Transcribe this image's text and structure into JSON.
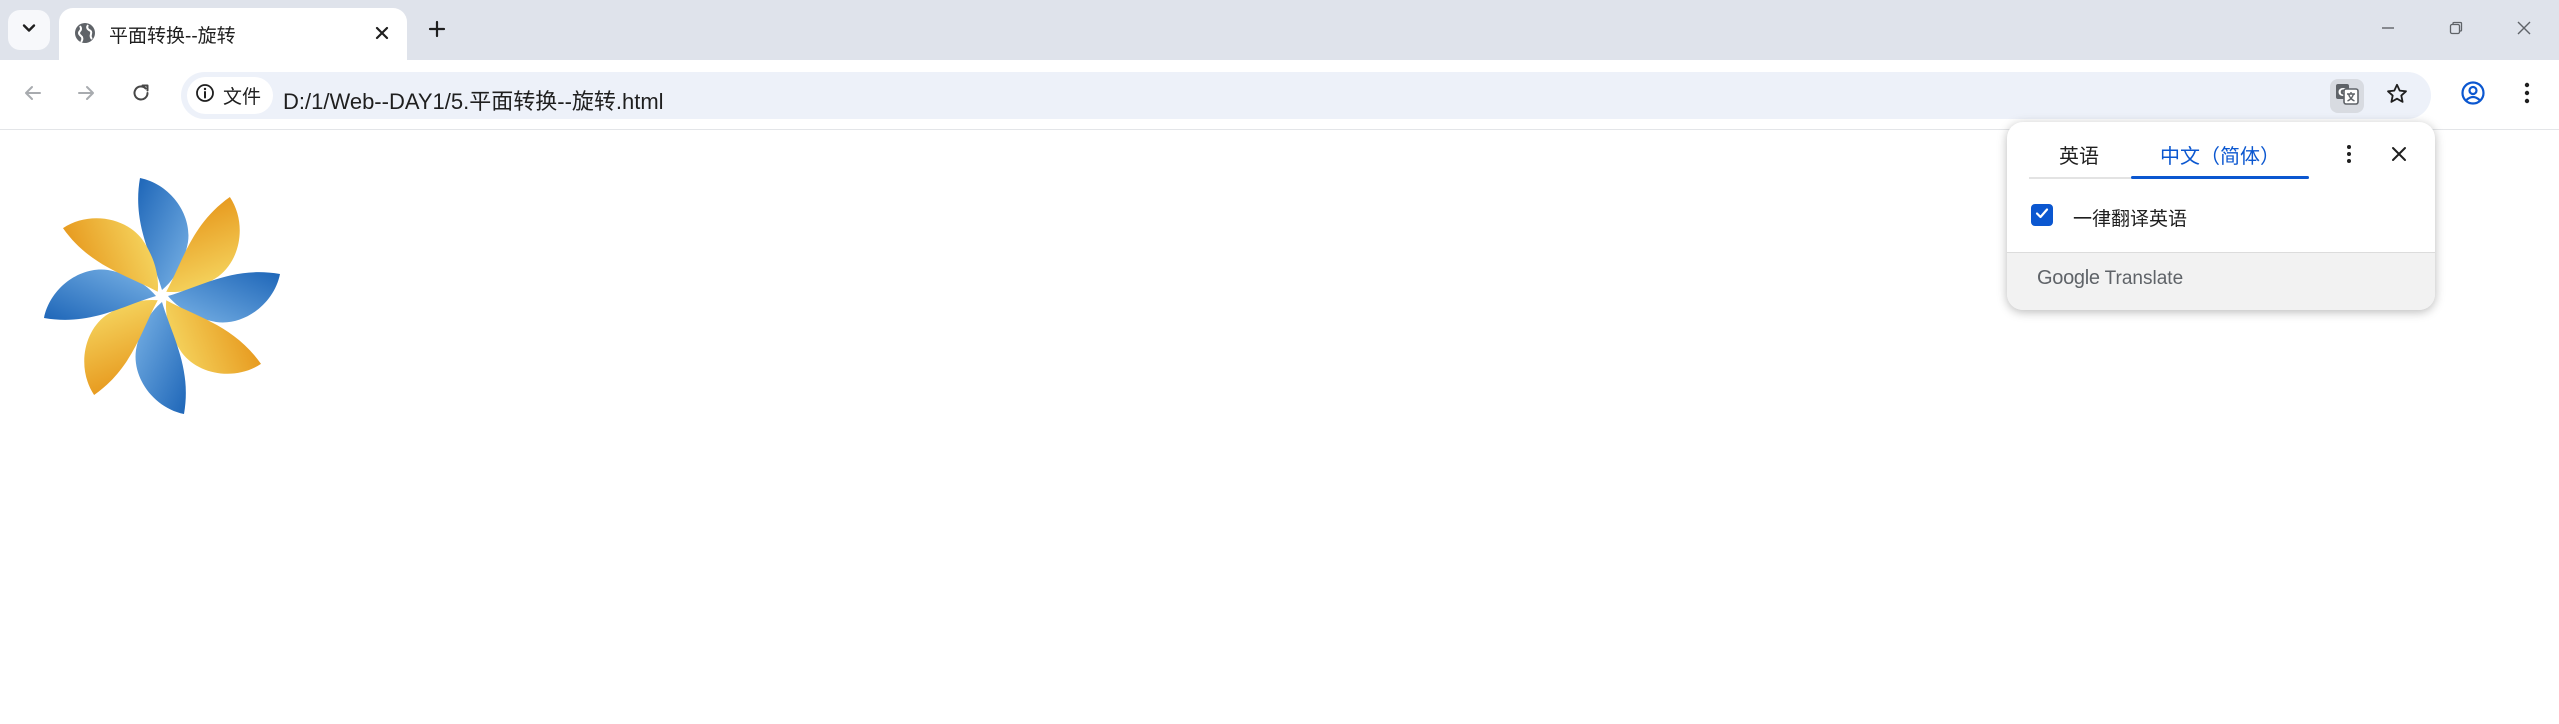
{
  "browser": {
    "tab": {
      "title": "平面转换--旋转"
    },
    "address_bar": {
      "chip_label": "文件",
      "url": "D:/1/Web--DAY1/5.平面转换--旋转.html"
    }
  },
  "translate_popup": {
    "source_language": "英语",
    "target_language": "中文（简体）",
    "always_translate_label": "一律翻译英语",
    "always_translate_checked": true,
    "footer_brand_google": "Google",
    "footer_brand_translate": "Translate"
  },
  "colors": {
    "accent": "#0b57d0",
    "pinwheel_blue": "#4a90d9",
    "pinwheel_yellow": "#f2c94c"
  }
}
